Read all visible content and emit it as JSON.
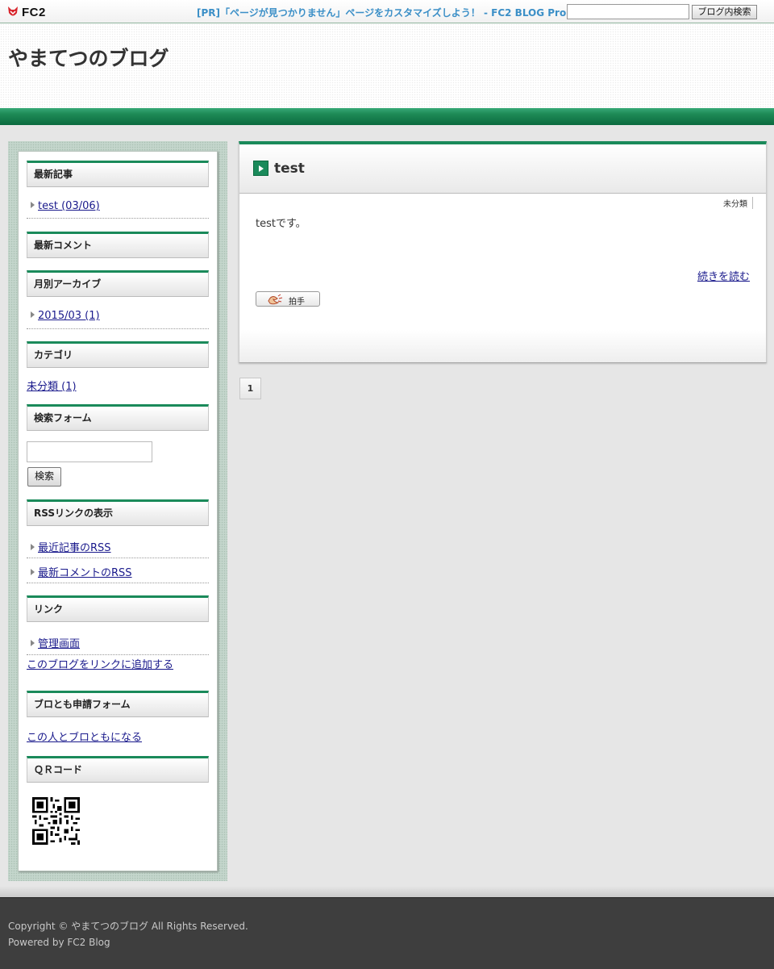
{
  "fc2bar": {
    "logo_text": "FC2",
    "pr_text": "[PR]「ページが見つかりません」ページをカスタマイズしよう！ - FC2 BLOG Pro",
    "search_value": "",
    "search_button": "ブログ内検索"
  },
  "header": {
    "blog_title": "やまてつのブログ"
  },
  "sidebar": {
    "recent_entries": {
      "title": "最新記事",
      "items": [
        "test (03/06)"
      ]
    },
    "recent_comments": {
      "title": "最新コメント"
    },
    "archives": {
      "title": "月別アーカイブ",
      "items": [
        "2015/03 (1)"
      ]
    },
    "categories": {
      "title": "カテゴリ",
      "items": [
        "未分類 (1)"
      ]
    },
    "search_form": {
      "title": "検索フォーム",
      "input_value": "",
      "button": "検索"
    },
    "rss": {
      "title": "RSSリンクの表示",
      "items": [
        "最近記事のRSS",
        "最新コメントのRSS"
      ]
    },
    "links": {
      "title": "リンク",
      "items": [
        "管理画面"
      ],
      "add_link": "このブログをリンクに追加する"
    },
    "blotomo": {
      "title": "ブロとも申請フォーム",
      "link": "この人とブロともになる"
    },
    "qr": {
      "title": "ＱＲコード"
    }
  },
  "entry": {
    "title": "test",
    "body": "testです。",
    "read_more": "続きを読む",
    "clap_label": "拍手",
    "category": "未分類"
  },
  "pager": {
    "current": "1"
  },
  "footer": {
    "copyright": "Copyright © やまてつのブログ All Rights Reserved.",
    "powered": "Powered by FC2 Blog"
  }
}
